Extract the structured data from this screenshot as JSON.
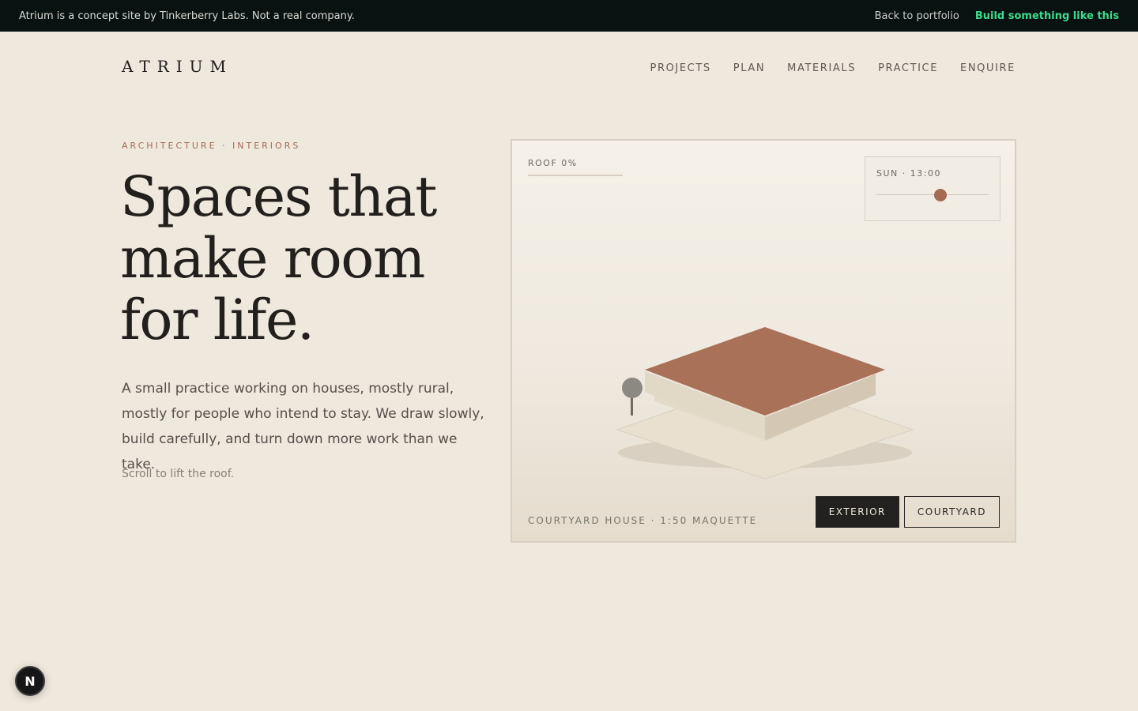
{
  "banner": {
    "note": "Atrium is a concept site by Tinkerberry Labs. Not a real company.",
    "back_link": "Back to portfolio",
    "cta_link": "Build something like this"
  },
  "header": {
    "logo": "ATRIUM",
    "nav": [
      "PROJECTS",
      "PLAN",
      "MATERIALS",
      "PRACTICE",
      "ENQUIRE"
    ]
  },
  "hero": {
    "eyebrow": "ARCHITECTURE · INTERIORS",
    "headline_lines": [
      "Spaces that",
      "make room",
      "for life."
    ],
    "lede": "A small practice working on houses, mostly rural, mostly for people who intend to stay. We draw slowly, build carefully, and turn down more work than we take.",
    "hint": "Scroll to lift the roof."
  },
  "model": {
    "roof_label": "ROOF 0%",
    "roof_progress": 0,
    "sun_label": "SUN · 13:00",
    "sun_position": 0.57,
    "caption": "COURTYARD HOUSE · 1:50 MAQUETTE",
    "views": [
      {
        "label": "EXTERIOR",
        "active": true
      },
      {
        "label": "COURTYARD",
        "active": false
      }
    ],
    "colors": {
      "roof": "#a87158",
      "wall": "#ddd3c2",
      "ground": "#e6dccb",
      "accent": "#a46a53"
    }
  },
  "badge": {
    "letter": "N"
  }
}
